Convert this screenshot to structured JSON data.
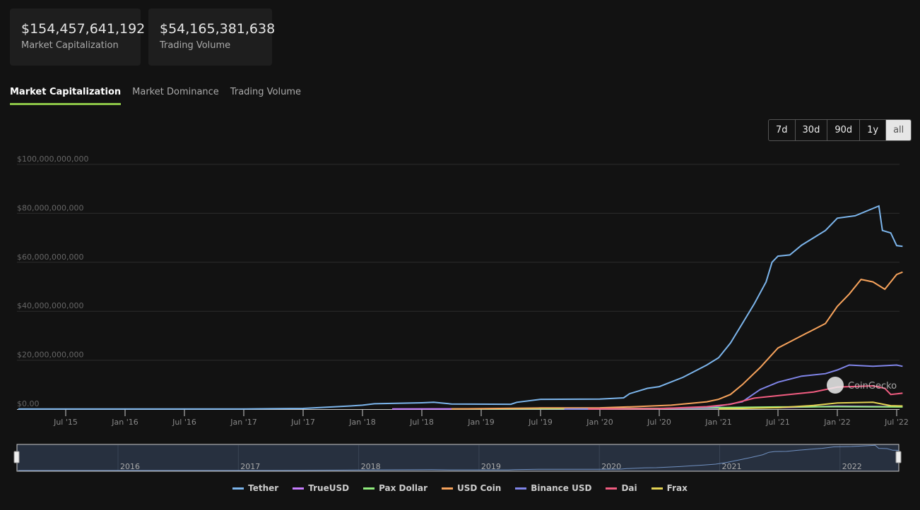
{
  "stats": [
    {
      "value": "$154,457,641,192",
      "label": "Market Capitalization"
    },
    {
      "value": "$54,165,381,638",
      "label": "Trading Volume"
    }
  ],
  "tabs": [
    "Market Capitalization",
    "Market Dominance",
    "Trading Volume"
  ],
  "ranges": [
    "7d",
    "30d",
    "90d",
    "1y",
    "all"
  ],
  "watermark": "CoinGecko",
  "chart_data": {
    "type": "line",
    "title": "",
    "xlabel": "",
    "ylabel": "",
    "ylim": [
      0,
      100000000000
    ],
    "y_ticks": [
      "$0.00",
      "$20,000,000,000",
      "$40,000,000,000",
      "$60,000,000,000",
      "$80,000,000,000",
      "$100,000,000,000"
    ],
    "x_ticks": [
      {
        "t": 2015.5,
        "label": "Jul '15"
      },
      {
        "t": 2016,
        "label": "Jan '16"
      },
      {
        "t": 2016.5,
        "label": "Jul '16"
      },
      {
        "t": 2017,
        "label": "Jan '17"
      },
      {
        "t": 2017.5,
        "label": "Jul '17"
      },
      {
        "t": 2018,
        "label": "Jan '18"
      },
      {
        "t": 2018.5,
        "label": "Jul '18"
      },
      {
        "t": 2019,
        "label": "Jan '19"
      },
      {
        "t": 2019.5,
        "label": "Jul '19"
      },
      {
        "t": 2020,
        "label": "Jan '20"
      },
      {
        "t": 2020.5,
        "label": "Jul '20"
      },
      {
        "t": 2021,
        "label": "Jan '21"
      },
      {
        "t": 2021.5,
        "label": "Jul '21"
      },
      {
        "t": 2022,
        "label": "Jan '22"
      },
      {
        "t": 2022.5,
        "label": "Jul '22"
      }
    ],
    "navigator_labels": [
      "2016",
      "2017",
      "2018",
      "2019",
      "2020",
      "2021",
      "2022"
    ],
    "legend_position": "bottom",
    "unit": "billions USD",
    "series": [
      {
        "name": "Tether",
        "color": "#7cb5ec",
        "points": [
          [
            2015.1,
            0.1
          ],
          [
            2017.0,
            0.1
          ],
          [
            2017.5,
            0.3
          ],
          [
            2017.9,
            1.3
          ],
          [
            2018.0,
            1.6
          ],
          [
            2018.1,
            2.2
          ],
          [
            2018.5,
            2.6
          ],
          [
            2018.6,
            2.8
          ],
          [
            2018.75,
            2.1
          ],
          [
            2019.25,
            2.0
          ],
          [
            2019.3,
            2.8
          ],
          [
            2019.5,
            4.0
          ],
          [
            2020.0,
            4.1
          ],
          [
            2020.2,
            4.6
          ],
          [
            2020.25,
            6.3
          ],
          [
            2020.4,
            8.5
          ],
          [
            2020.5,
            9.2
          ],
          [
            2020.7,
            13
          ],
          [
            2020.9,
            18
          ],
          [
            2021.0,
            21
          ],
          [
            2021.1,
            27
          ],
          [
            2021.2,
            35
          ],
          [
            2021.3,
            43
          ],
          [
            2021.4,
            52
          ],
          [
            2021.45,
            60
          ],
          [
            2021.5,
            62.5
          ],
          [
            2021.6,
            63
          ],
          [
            2021.7,
            67
          ],
          [
            2021.8,
            70
          ],
          [
            2021.9,
            73
          ],
          [
            2022.0,
            78
          ],
          [
            2022.15,
            79
          ],
          [
            2022.3,
            82
          ],
          [
            2022.35,
            83
          ],
          [
            2022.38,
            73
          ],
          [
            2022.45,
            72
          ],
          [
            2022.5,
            66.8
          ],
          [
            2022.55,
            66.5
          ]
        ]
      },
      {
        "name": "TrueUSD",
        "color": "#c77dff",
        "points": [
          [
            2018.25,
            0.05
          ],
          [
            2019.5,
            0.2
          ],
          [
            2020.5,
            0.3
          ],
          [
            2021.0,
            0.4
          ],
          [
            2021.5,
            0.6
          ],
          [
            2022.0,
            1.2
          ],
          [
            2022.55,
            1.0
          ]
        ]
      },
      {
        "name": "Pax Dollar",
        "color": "#90ed7d",
        "points": [
          [
            2018.75,
            0.05
          ],
          [
            2019.5,
            0.2
          ],
          [
            2020.5,
            0.3
          ],
          [
            2021.0,
            0.6
          ],
          [
            2021.5,
            0.9
          ],
          [
            2022.0,
            1.0
          ],
          [
            2022.55,
            0.9
          ]
        ]
      },
      {
        "name": "USD Coin",
        "color": "#f7a35c",
        "points": [
          [
            2018.75,
            0.1
          ],
          [
            2019.5,
            0.5
          ],
          [
            2020.0,
            0.55
          ],
          [
            2020.3,
            1
          ],
          [
            2020.6,
            1.6
          ],
          [
            2020.9,
            3
          ],
          [
            2021.0,
            4
          ],
          [
            2021.1,
            6
          ],
          [
            2021.2,
            10
          ],
          [
            2021.35,
            17
          ],
          [
            2021.5,
            25
          ],
          [
            2021.6,
            27.5
          ],
          [
            2021.7,
            30
          ],
          [
            2021.9,
            35
          ],
          [
            2022.0,
            42
          ],
          [
            2022.1,
            47
          ],
          [
            2022.2,
            53
          ],
          [
            2022.3,
            52
          ],
          [
            2022.4,
            49
          ],
          [
            2022.45,
            52
          ],
          [
            2022.5,
            55
          ],
          [
            2022.55,
            56
          ]
        ]
      },
      {
        "name": "Binance USD",
        "color": "#8085e9",
        "points": [
          [
            2019.7,
            0.02
          ],
          [
            2020.5,
            0.2
          ],
          [
            2020.9,
            0.8
          ],
          [
            2021.0,
            1.2
          ],
          [
            2021.2,
            3
          ],
          [
            2021.35,
            8
          ],
          [
            2021.5,
            11
          ],
          [
            2021.7,
            13.5
          ],
          [
            2021.9,
            14.5
          ],
          [
            2022.0,
            16
          ],
          [
            2022.1,
            18
          ],
          [
            2022.3,
            17.5
          ],
          [
            2022.5,
            18
          ],
          [
            2022.55,
            17.5
          ]
        ]
      },
      {
        "name": "Dai",
        "color": "#f15c80",
        "points": [
          [
            2019.9,
            0.1
          ],
          [
            2020.5,
            0.2
          ],
          [
            2020.9,
            1
          ],
          [
            2021.1,
            2
          ],
          [
            2021.3,
            4.5
          ],
          [
            2021.5,
            5.5
          ],
          [
            2021.8,
            7
          ],
          [
            2022.0,
            9
          ],
          [
            2022.3,
            9.5
          ],
          [
            2022.4,
            8.5
          ],
          [
            2022.45,
            6
          ],
          [
            2022.55,
            6.5
          ]
        ]
      },
      {
        "name": "Frax",
        "color": "#e4d354",
        "points": [
          [
            2021.0,
            0.1
          ],
          [
            2021.5,
            0.6
          ],
          [
            2021.8,
            1.5
          ],
          [
            2022.0,
            2.5
          ],
          [
            2022.3,
            2.8
          ],
          [
            2022.45,
            1.4
          ],
          [
            2022.55,
            1.3
          ]
        ]
      }
    ]
  }
}
